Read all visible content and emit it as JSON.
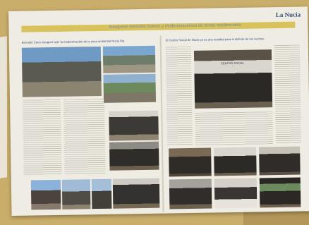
{
  "newspaper": {
    "masthead": "La Nucia",
    "headline": "Inauguran servicios nuevos y modernizaciones de zonas residenciales",
    "left_caption": "Bernabé Cano inauguró ayer la modernización de la zona ambiental Nucia Pat",
    "right_caption": "El Centro Social de Nucia ya es una realidad para el disfrute de los vecinos",
    "banner_text": "CENTRO SOCIAL"
  },
  "colors": {
    "background": "#c9ad6a",
    "paper": "#efece4",
    "band": "#d8c25c",
    "masthead": "#2f4c74"
  }
}
